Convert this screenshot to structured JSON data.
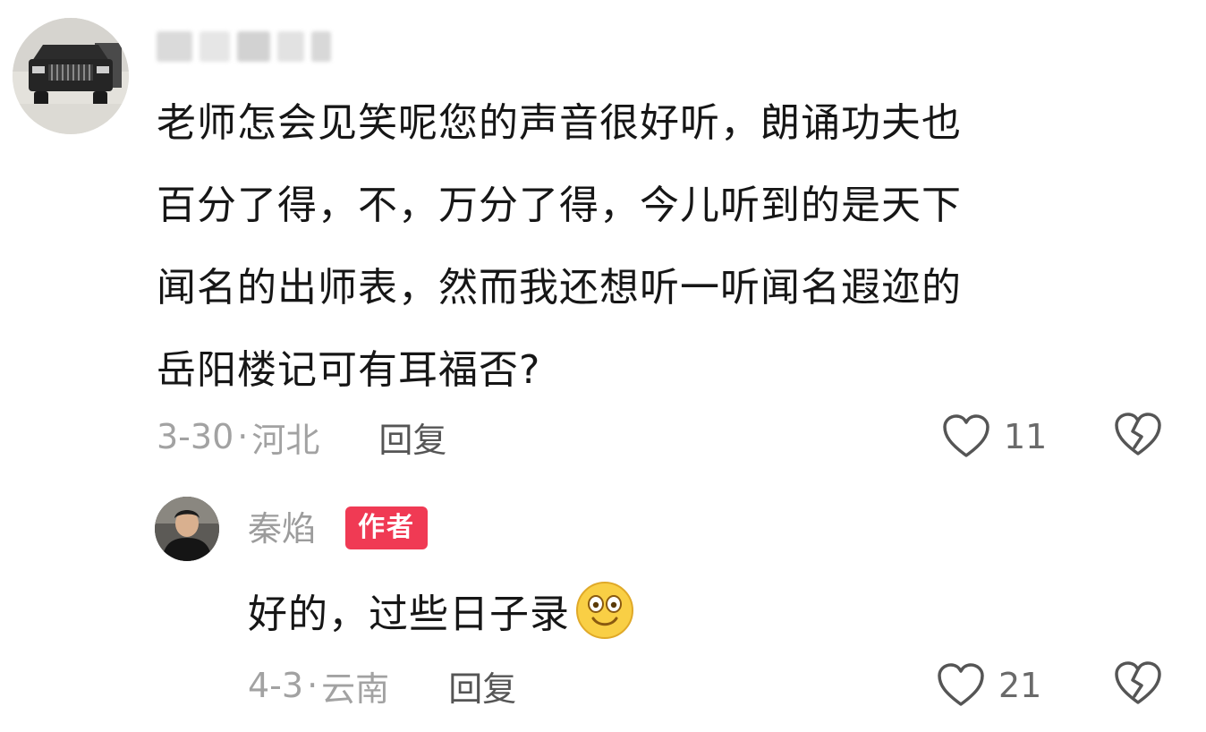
{
  "comment": {
    "text_lines": [
      "老师怎会见笑呢您的声音很好听，朗诵功夫也",
      "百分了得，不，万分了得，今儿听到的是天下",
      "闻名的出师表，然而我还想听一听闻名遐迩的",
      "岳阳楼记可有耳福否?"
    ],
    "date": "3-30",
    "separator": "·",
    "location": "河北",
    "reply_label": "回复",
    "like_count": "11"
  },
  "reply": {
    "author_name": "秦焰",
    "author_badge": "作者",
    "text": "好的，过些日子录",
    "emoji": "smiling-face-emoji",
    "date": "4-3",
    "separator": "·",
    "location": "云南",
    "reply_label": "回复",
    "like_count": "21"
  },
  "icons": {
    "like": "heart-outline-icon",
    "dislike": "broken-heart-icon"
  },
  "colors": {
    "badge_background": "#f03a54",
    "meta_text": "#a2a2a2",
    "body_text": "#161616"
  }
}
